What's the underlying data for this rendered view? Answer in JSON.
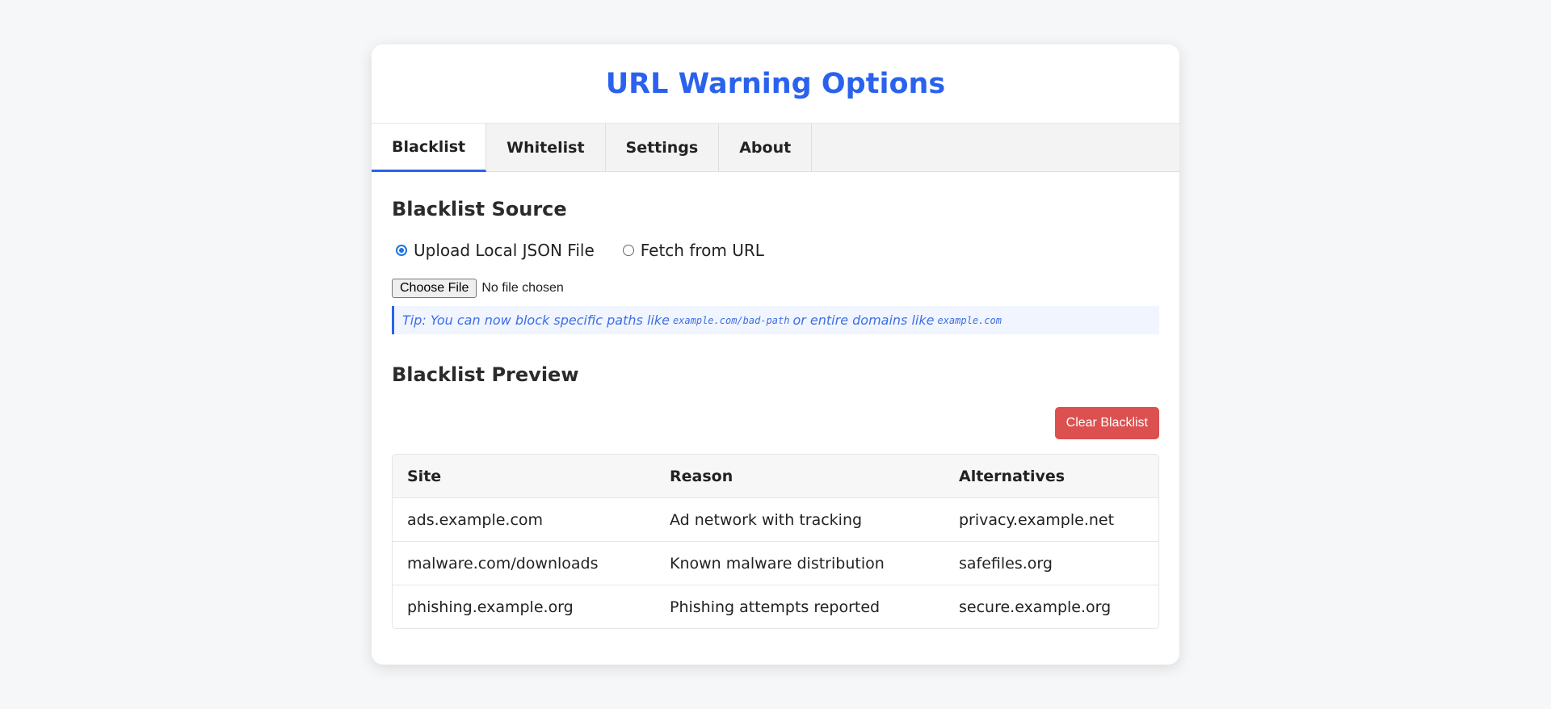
{
  "header": {
    "title": "URL Warning Options"
  },
  "tabs": [
    {
      "label": "Blacklist",
      "active": true
    },
    {
      "label": "Whitelist",
      "active": false
    },
    {
      "label": "Settings",
      "active": false
    },
    {
      "label": "About",
      "active": false
    }
  ],
  "source": {
    "title": "Blacklist Source",
    "options": [
      {
        "label": "Upload Local JSON File",
        "selected": true
      },
      {
        "label": "Fetch from URL",
        "selected": false
      }
    ],
    "file_button": "Choose File",
    "file_status": "No file chosen",
    "tip": {
      "prefix": "Tip: You can now block specific paths like",
      "example_path": "example.com/bad-path",
      "middle": "or entire domains like",
      "example_domain": "example.com"
    }
  },
  "preview": {
    "title": "Blacklist Preview",
    "clear_button": "Clear Blacklist",
    "columns": [
      "Site",
      "Reason",
      "Alternatives"
    ],
    "rows": [
      [
        "ads.example.com",
        "Ad network with tracking",
        "privacy.example.net"
      ],
      [
        "malware.com/downloads",
        "Known malware distribution",
        "safefiles.org"
      ],
      [
        "phishing.example.org",
        "Phishing attempts reported",
        "secure.example.org"
      ]
    ]
  },
  "colors": {
    "accent": "#2a62ee",
    "danger": "#dc5050",
    "background": "#f6f7f9"
  }
}
